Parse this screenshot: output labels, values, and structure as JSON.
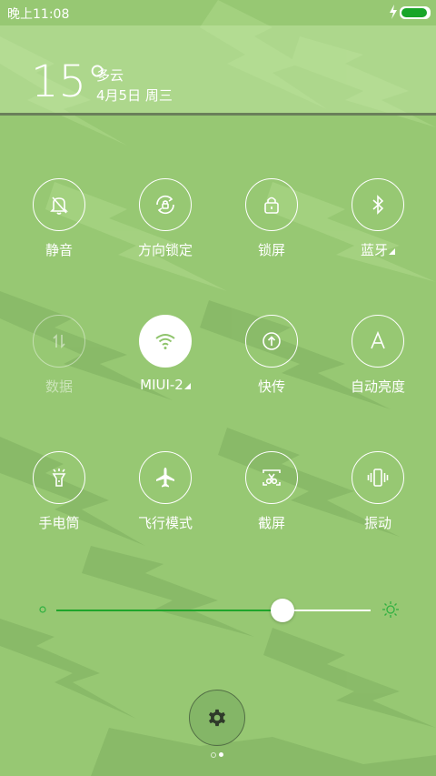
{
  "status_bar": {
    "time": "晚上11:08",
    "battery_level": 1.0,
    "charging": true
  },
  "header": {
    "temperature": "15°",
    "weather": "多云",
    "date": "4月5日 周三"
  },
  "tiles": [
    {
      "label": "静音",
      "icon": "bell-off-icon",
      "state": "off"
    },
    {
      "label": "方向锁定",
      "icon": "rotation-lock-icon",
      "state": "off"
    },
    {
      "label": "锁屏",
      "icon": "lock-icon",
      "state": "off"
    },
    {
      "label": "蓝牙",
      "icon": "bluetooth-icon",
      "state": "off",
      "has_menu": true
    },
    {
      "label": "数据",
      "icon": "mobile-data-icon",
      "state": "disabled"
    },
    {
      "label": "MIUI-2",
      "icon": "wifi-icon",
      "state": "on",
      "has_menu": true
    },
    {
      "label": "快传",
      "icon": "fast-transfer-icon",
      "state": "off"
    },
    {
      "label": "自动亮度",
      "icon": "auto-brightness-icon",
      "state": "off"
    },
    {
      "label": "手电筒",
      "icon": "flashlight-icon",
      "state": "off"
    },
    {
      "label": "飞行模式",
      "icon": "airplane-icon",
      "state": "off"
    },
    {
      "label": "截屏",
      "icon": "screenshot-icon",
      "state": "off"
    },
    {
      "label": "振动",
      "icon": "vibrate-icon",
      "state": "off"
    }
  ],
  "brightness": {
    "level": 0.72
  },
  "page_indicator": {
    "total": 2,
    "current": 2
  },
  "colors": {
    "background": "#97c873",
    "slider_active": "#1fa52a",
    "battery": "#18a528"
  }
}
